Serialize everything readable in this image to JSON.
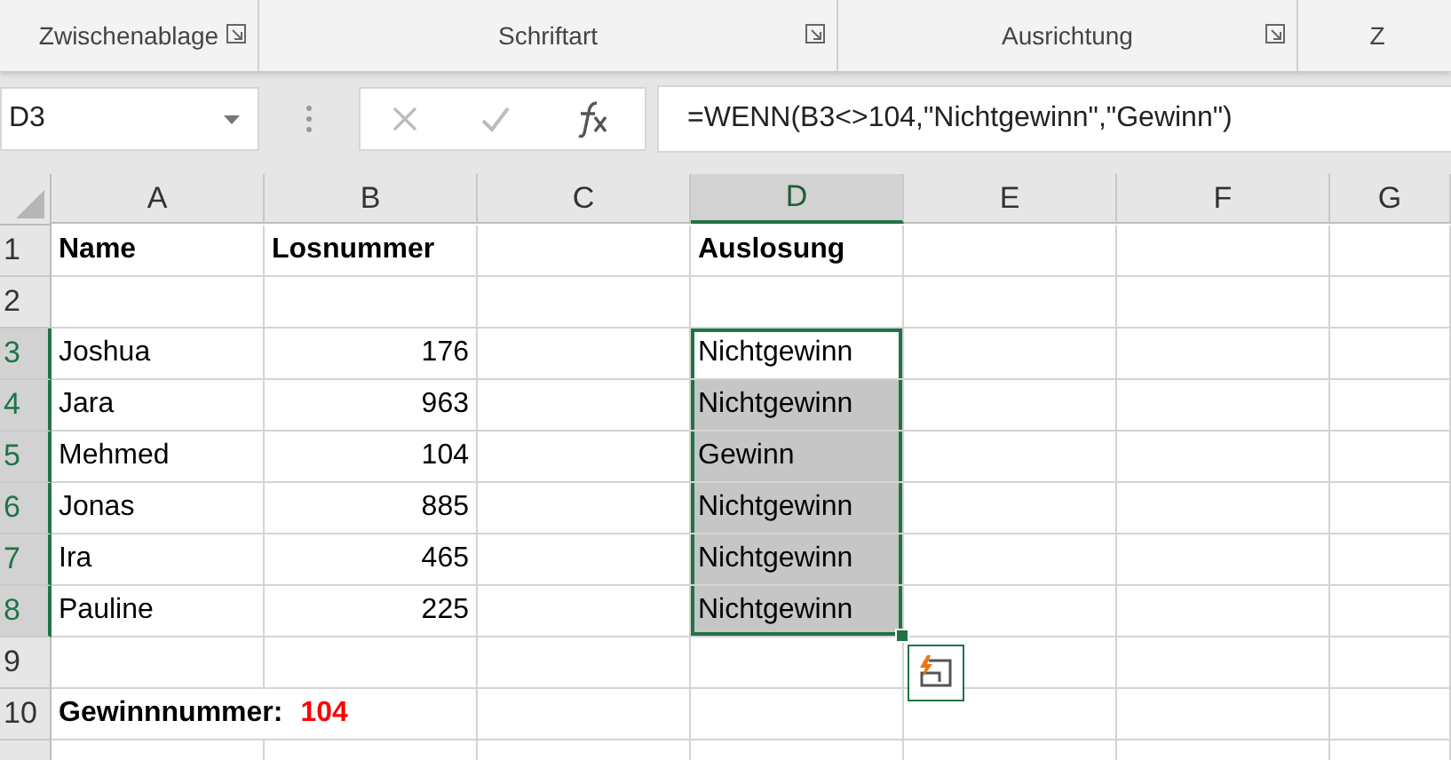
{
  "ribbon": {
    "groups": [
      {
        "label": "Zwischenablage",
        "dialog_launcher": true
      },
      {
        "label": "Schriftart",
        "dialog_launcher": true
      },
      {
        "label": "Ausrichtung",
        "dialog_launcher": true
      },
      {
        "label": "Z",
        "dialog_launcher": false
      }
    ]
  },
  "formula_bar": {
    "name_box": "D3",
    "formula": "=WENN(B3<>104,\"Nichtgewinn\",\"Gewinn\")"
  },
  "columns": [
    {
      "label": "A",
      "selected": false
    },
    {
      "label": "B",
      "selected": false
    },
    {
      "label": "C",
      "selected": false
    },
    {
      "label": "D",
      "selected": true
    },
    {
      "label": "E",
      "selected": false
    },
    {
      "label": "F",
      "selected": false
    },
    {
      "label": "G",
      "selected": false
    }
  ],
  "rows": [
    {
      "label": "1",
      "selected": false,
      "cells": {
        "A": {
          "text": "Name",
          "bold": true,
          "kind": "text"
        },
        "B": {
          "text": "Losnummer",
          "bold": true,
          "kind": "text"
        },
        "D": {
          "text": "Auslosung",
          "bold": true,
          "kind": "text"
        }
      }
    },
    {
      "label": "2",
      "selected": false,
      "cells": {}
    },
    {
      "label": "3",
      "selected": true,
      "cells": {
        "A": {
          "text": "Joshua",
          "bold": false,
          "kind": "text"
        },
        "B": {
          "text": "176",
          "bold": false,
          "kind": "number"
        },
        "D": {
          "text": "Nichtgewinn",
          "bold": false,
          "kind": "text",
          "selected": true,
          "active": true
        }
      }
    },
    {
      "label": "4",
      "selected": true,
      "cells": {
        "A": {
          "text": "Jara",
          "bold": false,
          "kind": "text"
        },
        "B": {
          "text": "963",
          "bold": false,
          "kind": "number"
        },
        "D": {
          "text": "Nichtgewinn",
          "bold": false,
          "kind": "text",
          "selected": true,
          "active": false
        }
      }
    },
    {
      "label": "5",
      "selected": true,
      "cells": {
        "A": {
          "text": "Mehmed",
          "bold": false,
          "kind": "text"
        },
        "B": {
          "text": "104",
          "bold": false,
          "kind": "number"
        },
        "D": {
          "text": "Gewinn",
          "bold": false,
          "kind": "text",
          "selected": true,
          "active": false
        }
      }
    },
    {
      "label": "6",
      "selected": true,
      "cells": {
        "A": {
          "text": "Jonas",
          "bold": false,
          "kind": "text"
        },
        "B": {
          "text": "885",
          "bold": false,
          "kind": "number"
        },
        "D": {
          "text": "Nichtgewinn",
          "bold": false,
          "kind": "text",
          "selected": true,
          "active": false
        }
      }
    },
    {
      "label": "7",
      "selected": true,
      "cells": {
        "A": {
          "text": "Ira",
          "bold": false,
          "kind": "text"
        },
        "B": {
          "text": "465",
          "bold": false,
          "kind": "number"
        },
        "D": {
          "text": "Nichtgewinn",
          "bold": false,
          "kind": "text",
          "selected": true,
          "active": false
        }
      }
    },
    {
      "label": "8",
      "selected": true,
      "cells": {
        "A": {
          "text": "Pauline",
          "bold": false,
          "kind": "text"
        },
        "B": {
          "text": "225",
          "bold": false,
          "kind": "number"
        },
        "D": {
          "text": "Nichtgewinn",
          "bold": false,
          "kind": "text",
          "selected": true,
          "active": false
        }
      }
    },
    {
      "label": "9",
      "selected": false,
      "cells": {}
    },
    {
      "label": "10",
      "selected": false,
      "cells": {
        "A": {
          "bold": true,
          "kind": "rich",
          "parts": [
            {
              "text": "Gewinnnummer:",
              "color": "#000000"
            },
            {
              "text": "104",
              "color": "#ff0000"
            }
          ]
        }
      }
    }
  ]
}
